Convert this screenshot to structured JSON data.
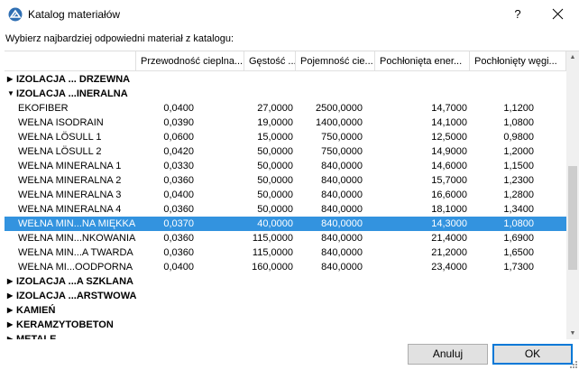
{
  "window": {
    "title": "Katalog materiałów",
    "help_label": "?"
  },
  "instruction": "Wybierz najbardziej odpowiedni materiał z katalogu:",
  "columns": [
    "Przewodność cieplna...",
    "Gęstość ...",
    "Pojemność cie...",
    "Pochłonięta ener...",
    "Pochłonięty węgi..."
  ],
  "rows": [
    {
      "type": "group",
      "expanded": false,
      "name": "IZOLACJA ... DRZEWNA"
    },
    {
      "type": "group",
      "expanded": true,
      "name": "IZOLACJA ...INERALNA"
    },
    {
      "type": "item",
      "selected": false,
      "name": "EKOFIBER",
      "values": [
        "0,0400",
        "27,0000",
        "2500,0000",
        "14,7000",
        "1,1200"
      ]
    },
    {
      "type": "item",
      "selected": false,
      "name": "WEŁNA ISODRAIN",
      "values": [
        "0,0390",
        "19,0000",
        "1400,0000",
        "14,1000",
        "1,0800"
      ]
    },
    {
      "type": "item",
      "selected": false,
      "name": "WEŁNA LÖSULL 1",
      "values": [
        "0,0600",
        "15,0000",
        "750,0000",
        "12,5000",
        "0,9800"
      ]
    },
    {
      "type": "item",
      "selected": false,
      "name": "WEŁNA LÖSULL 2",
      "values": [
        "0,0420",
        "50,0000",
        "750,0000",
        "14,9000",
        "1,2000"
      ]
    },
    {
      "type": "item",
      "selected": false,
      "name": "WEŁNA MINERALNA 1",
      "values": [
        "0,0330",
        "50,0000",
        "840,0000",
        "14,6000",
        "1,1500"
      ]
    },
    {
      "type": "item",
      "selected": false,
      "name": "WEŁNA MINERALNA 2",
      "values": [
        "0,0360",
        "50,0000",
        "840,0000",
        "15,7000",
        "1,2300"
      ]
    },
    {
      "type": "item",
      "selected": false,
      "name": "WEŁNA MINERALNA 3",
      "values": [
        "0,0400",
        "50,0000",
        "840,0000",
        "16,6000",
        "1,2800"
      ]
    },
    {
      "type": "item",
      "selected": false,
      "name": "WEŁNA MINERALNA 4",
      "values": [
        "0,0360",
        "50,0000",
        "840,0000",
        "18,1000",
        "1,3400"
      ]
    },
    {
      "type": "item",
      "selected": true,
      "name": "WEŁNA MIN...NA MIĘKKA",
      "values": [
        "0,0370",
        "40,0000",
        "840,0000",
        "14,3000",
        "1,0800"
      ]
    },
    {
      "type": "item",
      "selected": false,
      "name": "WEŁNA MIN...NKOWANIA",
      "values": [
        "0,0360",
        "115,0000",
        "840,0000",
        "21,4000",
        "1,6900"
      ]
    },
    {
      "type": "item",
      "selected": false,
      "name": "WEŁNA MIN...A TWARDA",
      "values": [
        "0,0360",
        "115,0000",
        "840,0000",
        "21,2000",
        "1,6500"
      ]
    },
    {
      "type": "item",
      "selected": false,
      "name": "WEŁNA MI...OODPORNA",
      "values": [
        "0,0400",
        "160,0000",
        "840,0000",
        "23,4000",
        "1,7300"
      ]
    },
    {
      "type": "group",
      "expanded": false,
      "name": "IZOLACJA ...A SZKLANA"
    },
    {
      "type": "group",
      "expanded": false,
      "name": "IZOLACJA ...ARSTWOWA"
    },
    {
      "type": "group",
      "expanded": false,
      "name": "KAMIEŃ"
    },
    {
      "type": "group",
      "expanded": false,
      "name": "KERAMZYTOBETON"
    },
    {
      "type": "group",
      "expanded": false,
      "name": "METALE"
    }
  ],
  "buttons": {
    "cancel": "Anuluj",
    "ok": "OK"
  },
  "colors": {
    "selection": "#3393df",
    "ok_border": "#0078d7"
  }
}
